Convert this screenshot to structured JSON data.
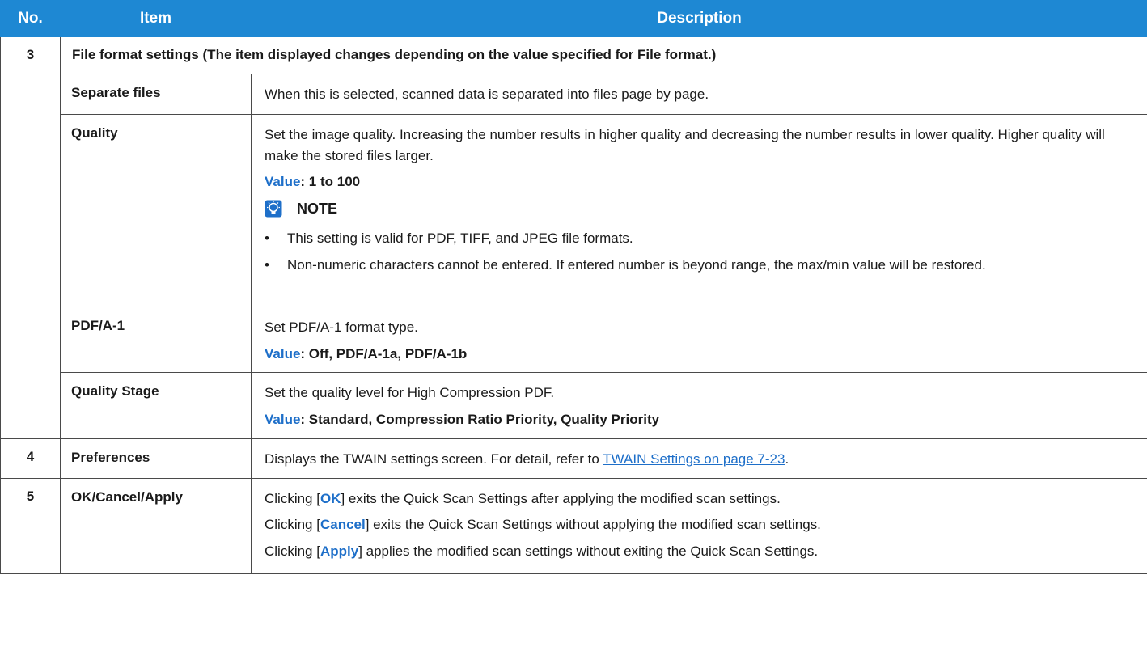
{
  "headers": {
    "no": "No.",
    "item": "Item",
    "description": "Description"
  },
  "rows": [
    {
      "no": "3",
      "section_title": "File format settings (The item displayed changes depending on the value specified for File format.)",
      "subrows": [
        {
          "item": "Separate files",
          "desc": "When this is selected, scanned data is separated into files page by page."
        },
        {
          "item": "Quality",
          "desc": "Set the image quality. Increasing the number results in higher quality and decreasing the number results in lower quality. Higher quality will make the stored files larger.",
          "value_label": "Value",
          "value_text": ": 1 to 100",
          "note_title": "NOTE",
          "note_bullets": [
            "This setting is valid for PDF, TIFF, and JPEG file formats.",
            "Non-numeric characters cannot be entered. If entered number is beyond range, the max/min value will be restored."
          ]
        },
        {
          "item": "PDF/A-1",
          "desc": "Set PDF/A-1 format type.",
          "value_label": "Value",
          "value_text": ": Off, PDF/A-1a, PDF/A-1b"
        },
        {
          "item": "Quality Stage",
          "desc": "Set the quality level for High Compression PDF.",
          "value_label": "Value",
          "value_text": ": Standard, Compression Ratio Priority, Quality Priority"
        }
      ]
    },
    {
      "no": "4",
      "item": "Preferences",
      "desc_prefix": "Displays the TWAIN settings screen. For detail, refer to ",
      "desc_link": "TWAIN Settings on page 7-23",
      "desc_suffix": "."
    },
    {
      "no": "5",
      "item": "OK/Cancel/Apply",
      "lines": [
        {
          "pre": "Clicking [",
          "btn": "OK",
          "post": "] exits the Quick Scan Settings after applying the modified scan settings."
        },
        {
          "pre": "Clicking [",
          "btn": "Cancel",
          "post": "] exits the Quick Scan Settings without applying the modified scan settings."
        },
        {
          "pre": "Clicking [",
          "btn": "Apply",
          "post": "] applies the modified scan settings without exiting the Quick Scan Settings."
        }
      ]
    }
  ],
  "colors": {
    "header_bg": "#1e88d3",
    "accent_text": "#1e6fc9",
    "border": "#4a4a4a"
  },
  "icons": {
    "note": "note-lightbulb-icon"
  }
}
